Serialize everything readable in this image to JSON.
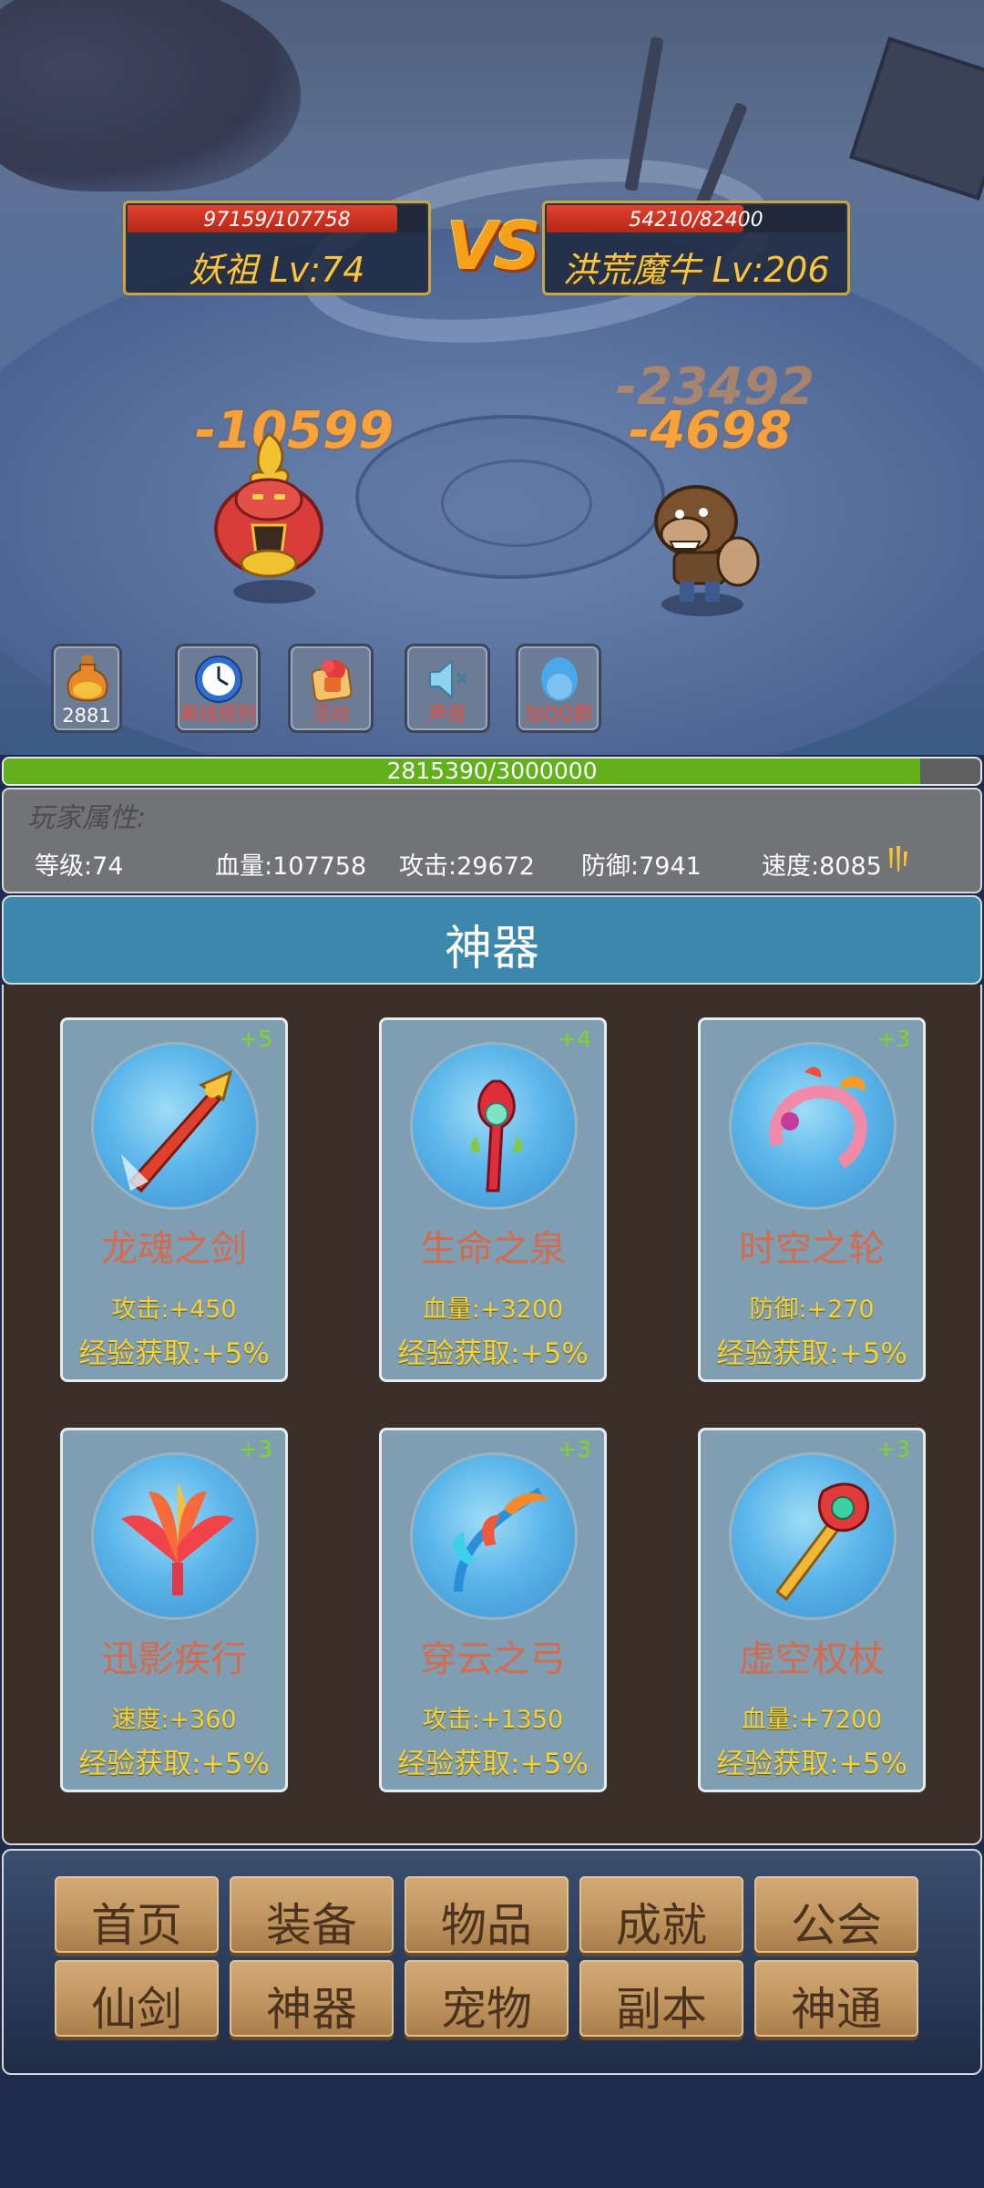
{
  "battle": {
    "player": {
      "hp_text": "97159/107758",
      "hp_fraction": 0.9017,
      "name": "妖祖 Lv:74"
    },
    "enemy": {
      "hp_text": "54210/82400",
      "hp_fraction": 0.6579,
      "name": "洪荒魔牛 Lv:206"
    },
    "vs_label": "VS",
    "damage": {
      "player_hit": "-10599",
      "enemy_hit_faded": "-23492",
      "enemy_hit": "-4698"
    }
  },
  "quick_buttons": [
    {
      "icon": "potion-icon",
      "label": "2881"
    },
    {
      "icon": "clock-icon",
      "label": "离线规则"
    },
    {
      "icon": "gift-icon",
      "label": "活动"
    },
    {
      "icon": "speaker-mute-icon",
      "label": "声音"
    },
    {
      "icon": "qq-penguin-icon",
      "label": "加QQ群"
    }
  ],
  "experience": {
    "text": "2815390/3000000",
    "fraction": 0.9385
  },
  "player_stats": {
    "title": "玩家属性:",
    "level": "等级:74",
    "hp": "血量:107758",
    "attack": "攻击:29672",
    "defense": "防御:7941",
    "speed": "速度:8085"
  },
  "artifact_section": {
    "title": "神器",
    "items": [
      {
        "level": "+5",
        "name": "龙魂之剑",
        "stat": "攻击:+450",
        "exp_bonus": "经验获取:+5%"
      },
      {
        "level": "+4",
        "name": "生命之泉",
        "stat": "血量:+3200",
        "exp_bonus": "经验获取:+5%"
      },
      {
        "level": "+3",
        "name": "时空之轮",
        "stat": "防御:+270",
        "exp_bonus": "经验获取:+5%"
      },
      {
        "level": "+3",
        "name": "迅影疾行",
        "stat": "速度:+360",
        "exp_bonus": "经验获取:+5%"
      },
      {
        "level": "+3",
        "name": "穿云之弓",
        "stat": "攻击:+1350",
        "exp_bonus": "经验获取:+5%"
      },
      {
        "level": "+3",
        "name": "虚空权杖",
        "stat": "血量:+7200",
        "exp_bonus": "经验获取:+5%"
      }
    ]
  },
  "bottom_menu": [
    "首页",
    "装备",
    "物品",
    "成就",
    "公会",
    "仙剑",
    "神器",
    "宠物",
    "副本",
    "神通"
  ],
  "colors": {
    "hp_red": "#d0321f",
    "exp_green": "#62b01c",
    "gold_text": "#f3d23a",
    "artifact_header": "#3c88ad"
  }
}
